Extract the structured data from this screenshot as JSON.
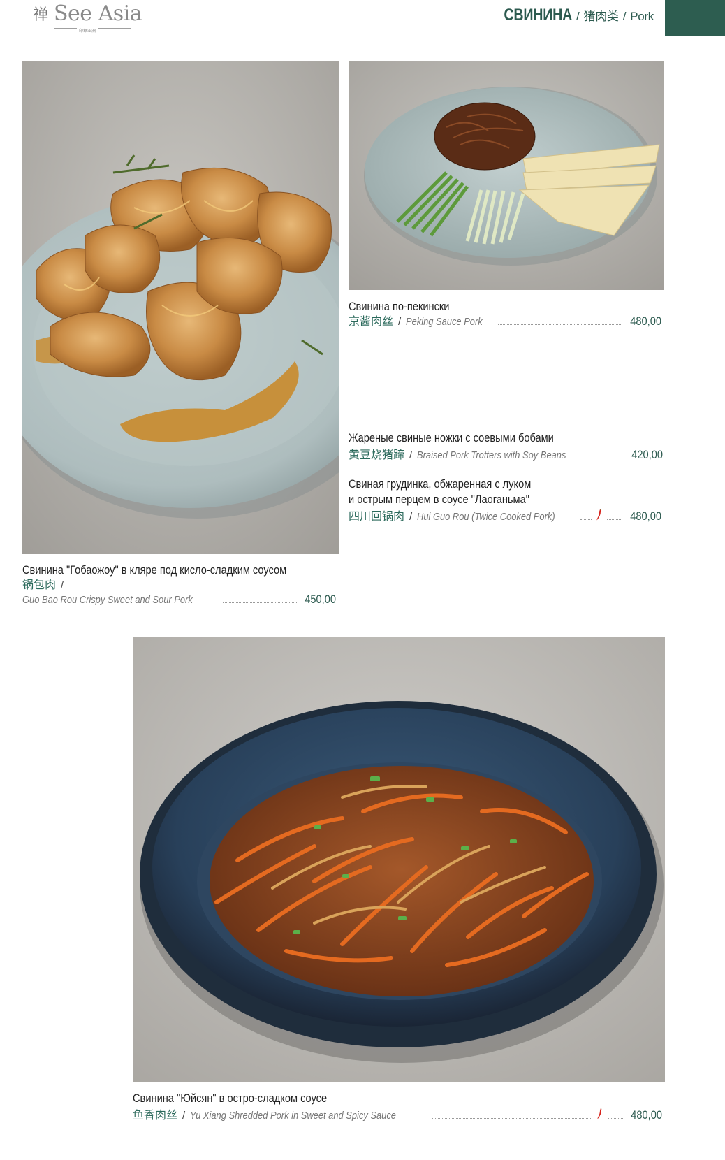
{
  "brand": {
    "logo_glyph": "禅",
    "logo_name": "See Asia",
    "logo_sub": "印象亚洲"
  },
  "header": {
    "title_ru": "СВИНИНА",
    "title_zh": "猪肉类",
    "title_en": "Pork",
    "separator": "/",
    "accent_color": "#2d5d50"
  },
  "photos": [
    {
      "name": "Crispy sweet and sour pork photo"
    },
    {
      "name": "Peking sauce pork photo"
    },
    {
      "name": "Yu Xiang shredded pork photo"
    }
  ],
  "menu": {
    "peking": {
      "name_ru": "Свинина по-пекински",
      "name_zh": "京酱肉丝",
      "name_en": "Peking Sauce Pork",
      "price": "480,00",
      "spicy": false
    },
    "trotters": {
      "name_ru": "Жареные свиные ножки с соевыми бобами",
      "name_zh": "黄豆烧猪蹄",
      "name_en": "Braised Pork Trotters with Soy Beans",
      "price": "420,00",
      "spicy": true
    },
    "huiguo": {
      "name_ru_line1": "Свиная грудинка, обжаренная с луком",
      "name_ru_line2": "и острым перцем в соусе \"Лаоганьма\"",
      "name_zh": "四川回锅肉",
      "name_en": "Hui Guo Rou (Twice Cooked Pork)",
      "price": "480,00",
      "spicy": true
    },
    "guobao": {
      "name_ru": "Свинина \"Гобаожоу\" в кляре под кисло-сладким соусом",
      "name_zh": "锅包肉",
      "name_en": "Guo Bao Rou Crispy Sweet and Sour Pork",
      "price": "450,00",
      "spicy": false
    },
    "yuxiang": {
      "name_ru": "Свинина \"Юйсян\" в остро-сладком соусе",
      "name_zh": "鱼香肉丝",
      "name_en": "Yu Xiang Shredded Pork in Sweet and Spicy Sauce",
      "price": "480,00",
      "spicy": true
    },
    "slash": "/"
  }
}
